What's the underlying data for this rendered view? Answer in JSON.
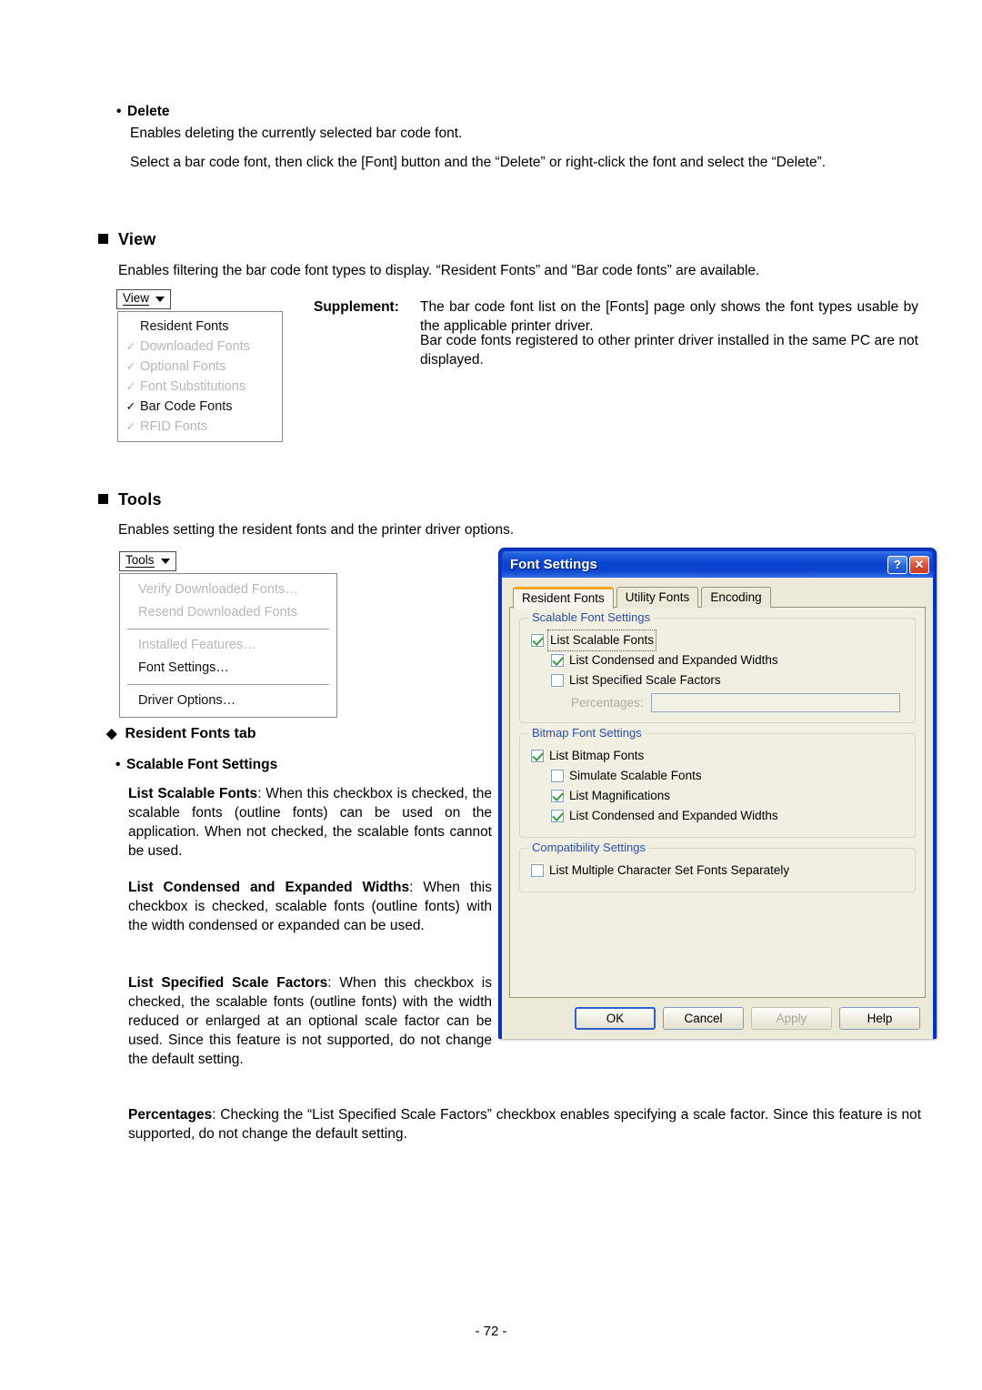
{
  "document": {
    "page_number": "- 72 -"
  },
  "delete_section": {
    "bullet": "•",
    "heading": "Delete",
    "line1": "Enables deleting the currently selected bar code font.",
    "line2": "Select a bar code font, then click the [Font] button and the “Delete” or right-click the font and select the “Delete”."
  },
  "view_section": {
    "heading": "View",
    "description": "Enables filtering the bar code font types to display.   “Resident Fonts” and “Bar code fonts” are available.",
    "menu_button": {
      "label": "View",
      "caret_icon": "caret-down-icon"
    },
    "menu_items": [
      {
        "label": "Resident Fonts",
        "checked": false,
        "enabled": true
      },
      {
        "label": "Downloaded Fonts",
        "checked": true,
        "enabled": false
      },
      {
        "label": "Optional Fonts",
        "checked": true,
        "enabled": false
      },
      {
        "label": "Font Substitutions",
        "checked": true,
        "enabled": false
      },
      {
        "label": "Bar Code Fonts",
        "checked": true,
        "enabled": true
      },
      {
        "label": "RFID Fonts",
        "checked": true,
        "enabled": false
      }
    ],
    "supplement": {
      "label": "Supplement",
      "colon": ":",
      "line1": "The bar code font list on the [Fonts] page only shows the font types usable by the applicable printer driver.",
      "line2": "Bar code fonts registered to other printer driver installed in the same PC are not displayed."
    }
  },
  "tools_section": {
    "heading": "Tools",
    "description": "Enables setting the resident fonts and the printer driver options.",
    "menu_button": {
      "label": "Tools",
      "caret_icon": "caret-down-icon"
    },
    "menu_items": [
      {
        "label": "Verify Downloaded Fonts…",
        "enabled": false,
        "separator_after": false
      },
      {
        "label": "Resend Downloaded Fonts",
        "enabled": false,
        "separator_after": true
      },
      {
        "label": "Installed Features…",
        "enabled": false,
        "separator_after": false
      },
      {
        "label": "Font Settings…",
        "enabled": true,
        "separator_after": true
      },
      {
        "label": "Driver Options…",
        "enabled": true,
        "separator_after": false
      }
    ]
  },
  "resident_tab_section": {
    "diamond": "◆",
    "heading": "Resident Fonts tab",
    "bullet": "•",
    "subheading": "Scalable Font Settings",
    "paragraphs": [
      {
        "term": "List Scalable Fonts",
        "colon": ":",
        "body": "When this checkbox is checked, the scalable fonts (outline fonts) can be used on the application.   When not checked, the scalable fonts cannot be used."
      },
      {
        "term": "List Condensed and Expanded Widths",
        "colon": ":",
        "body": "When this checkbox is checked, scalable fonts (outline fonts) with the width condensed or expanded can be used."
      },
      {
        "term": "List Specified Scale Factors",
        "colon": ":",
        "body": "When this checkbox is checked, the scalable fonts (outline fonts) with the width reduced or enlarged at an optional scale factor can be used.  Since this feature is not supported, do not change the default setting."
      }
    ],
    "percentages_paragraph": {
      "term": "Percentages",
      "colon": ":",
      "body": "Checking the “List Specified Scale Factors” checkbox enables specifying a scale factor. Since this feature is not supported, do not change the default setting."
    }
  },
  "font_settings_dialog": {
    "title": "Font Settings",
    "titlebar_buttons": [
      {
        "name": "help-button",
        "glyph": "?"
      },
      {
        "name": "close-button",
        "glyph": "✕"
      }
    ],
    "tabs": [
      {
        "label": "Resident Fonts",
        "active": true
      },
      {
        "label": "Utility Fonts",
        "active": false
      },
      {
        "label": "Encoding",
        "active": false
      }
    ],
    "groups": [
      {
        "legend": "Scalable Font Settings",
        "checkboxes": [
          {
            "label": "List Scalable Fonts",
            "checked": true,
            "indent": false,
            "focused": true
          },
          {
            "label": "List Condensed and Expanded Widths",
            "checked": true,
            "indent": true,
            "focused": false
          },
          {
            "label": "List Specified Scale Factors",
            "checked": false,
            "indent": true,
            "focused": false
          }
        ],
        "field": {
          "label": "Percentages:",
          "value": "",
          "enabled": false
        }
      },
      {
        "legend": "Bitmap Font Settings",
        "checkboxes": [
          {
            "label": "List Bitmap Fonts",
            "checked": true,
            "indent": false,
            "focused": false
          },
          {
            "label": "Simulate Scalable Fonts",
            "checked": false,
            "indent": true,
            "focused": false
          },
          {
            "label": "List Magnifications",
            "checked": true,
            "indent": true,
            "focused": false
          },
          {
            "label": "List Condensed and Expanded Widths",
            "checked": true,
            "indent": true,
            "focused": false
          }
        ]
      },
      {
        "legend": "Compatibility Settings",
        "checkboxes": [
          {
            "label": "List Multiple Character Set Fonts Separately",
            "checked": false,
            "indent": false,
            "focused": false
          }
        ]
      }
    ],
    "buttons": [
      {
        "label": "OK",
        "default": true,
        "enabled": true
      },
      {
        "label": "Cancel",
        "default": false,
        "enabled": true
      },
      {
        "label": "Apply",
        "default": false,
        "enabled": false
      },
      {
        "label": "Help",
        "default": false,
        "enabled": true
      }
    ]
  },
  "colors": {
    "title_blue": "#0b45d2",
    "dialog_face": "#ece9d8",
    "legend_blue": "#2a4fa8",
    "check_green": "#3a9b3a",
    "active_tab_orange": "#f5a623"
  }
}
